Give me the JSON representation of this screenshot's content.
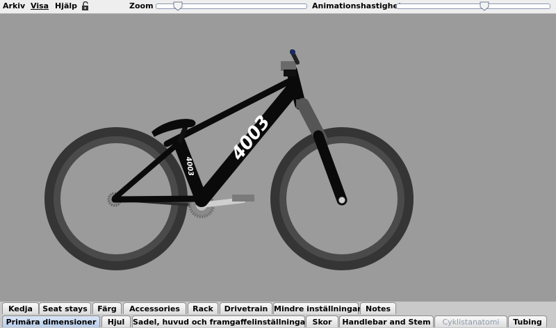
{
  "menubar": {
    "items": [
      {
        "label": "Arkiv"
      },
      {
        "label": "Visa"
      },
      {
        "label": "Hjälp"
      }
    ],
    "zoom_label": "Zoom",
    "zoom_level": 0.12,
    "animation_label": "Animationshastighet",
    "animation_level": 0.58
  },
  "bike": {
    "downtube_text": "4003",
    "seattube_text": "4003"
  },
  "tabs": {
    "row1": [
      "Kedja",
      "Seat stays",
      "Färg",
      "Accessories",
      "Rack",
      "Drivetrain",
      "Mindre inställningar",
      "Notes"
    ],
    "row2": [
      "Primära dimensioner",
      "Hjul",
      "Sadel, huvud och framgaffelinställningar",
      "Skor",
      "Handlebar and Stem",
      "Cyklistanatomi",
      "Tubing"
    ],
    "selected": "Primära dimensioner",
    "disabled": "Cyklistanatomi"
  },
  "colors": {
    "background": "#9b9b9b",
    "frame": "#0a0a0a",
    "tire_outer": "#3a3a3a",
    "tire_inner": "#555555",
    "selected_tab": "#c3d6ee"
  }
}
